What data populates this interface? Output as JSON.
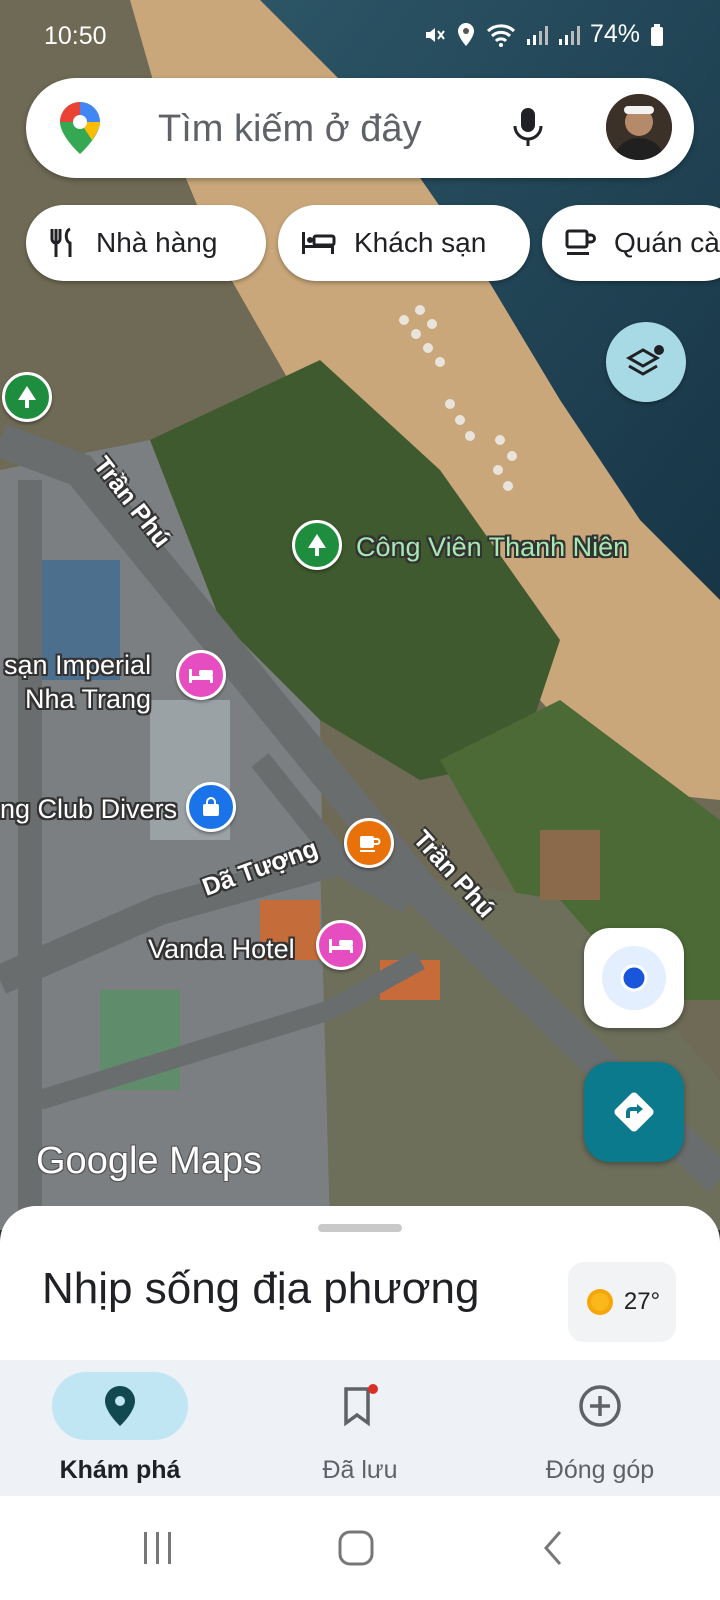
{
  "status_bar": {
    "time": "10:50",
    "battery": "74%",
    "icons": [
      "mute-icon",
      "location-icon",
      "wifi-icon",
      "signal-icon",
      "signal-icon",
      "battery-icon"
    ]
  },
  "search": {
    "placeholder": "Tìm kiếm ở đây",
    "logo_icon": "google-maps-pin-icon",
    "mic_icon": "microphone-icon"
  },
  "chips": [
    {
      "label": "Nhà hàng",
      "icon": "restaurant-icon"
    },
    {
      "label": "Khách sạn",
      "icon": "hotel-bed-icon"
    },
    {
      "label": "Quán cà",
      "icon": "coffee-cup-icon"
    }
  ],
  "map": {
    "places": [
      {
        "name": "Công Viên Thanh Niên",
        "category": "park",
        "color": "#1e8e3e"
      },
      {
        "name": "sạn Imperial\nNha Trang",
        "category": "hotel",
        "color": "#e54dc1"
      },
      {
        "name": "ng Club Divers",
        "category": "shopping",
        "color": "#1a73e8"
      },
      {
        "name": "Vanda Hotel",
        "category": "hotel",
        "color": "#e54dc1"
      },
      {
        "name": "",
        "category": "cafe",
        "color": "#e8710a"
      },
      {
        "name": "",
        "category": "park",
        "color": "#1e8e3e"
      }
    ],
    "streets": [
      "Trần Phú",
      "Dã Tượng",
      "Trần Phú"
    ],
    "watermark": "Google Maps"
  },
  "sheet": {
    "title": "Nhịp sống địa phương",
    "weather": "27°",
    "weather_icon": "sun-icon"
  },
  "bottom_nav": {
    "items": [
      {
        "label": "Khám phá",
        "icon": "location-pin-icon",
        "active": true
      },
      {
        "label": "Đã lưu",
        "icon": "bookmark-icon",
        "active": false,
        "badge": true
      },
      {
        "label": "Đóng góp",
        "icon": "add-circle-icon",
        "active": false
      }
    ]
  },
  "colors": {
    "accent": "#0b7a8c",
    "nav_active_bg": "#bfe6f2",
    "sand": "#c9a77a",
    "sea": "#1d3f52"
  }
}
